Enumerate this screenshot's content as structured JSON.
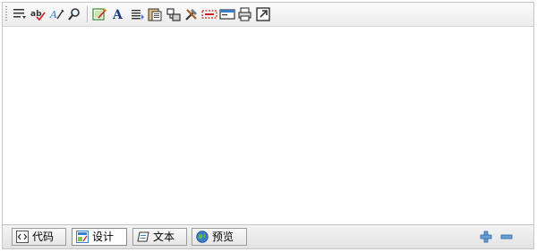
{
  "toolbar": {
    "buttons": [
      {
        "name": "paragraph-format-icon"
      },
      {
        "name": "spell-check-icon"
      },
      {
        "name": "font-style-icon"
      },
      {
        "name": "find-icon"
      },
      {
        "name": "edit-image-icon"
      },
      {
        "name": "font-color-icon"
      },
      {
        "name": "align-text-icon"
      },
      {
        "name": "paste-icon"
      },
      {
        "name": "insert-object-icon"
      },
      {
        "name": "tools-icon"
      },
      {
        "name": "horizontal-rule-icon"
      },
      {
        "name": "form-field-icon"
      },
      {
        "name": "print-icon"
      },
      {
        "name": "fullscreen-icon"
      }
    ]
  },
  "modes": {
    "code": "代码",
    "design": "设计",
    "text": "文本",
    "preview": "预览",
    "active": "design"
  },
  "resize": {
    "increase": "plus-icon",
    "decrease": "minus-icon"
  },
  "colors": {
    "accent_blue": "#3b7dc9",
    "icon_dark": "#333333",
    "icon_red": "#cc2222",
    "icon_green": "#3a8a2a"
  }
}
